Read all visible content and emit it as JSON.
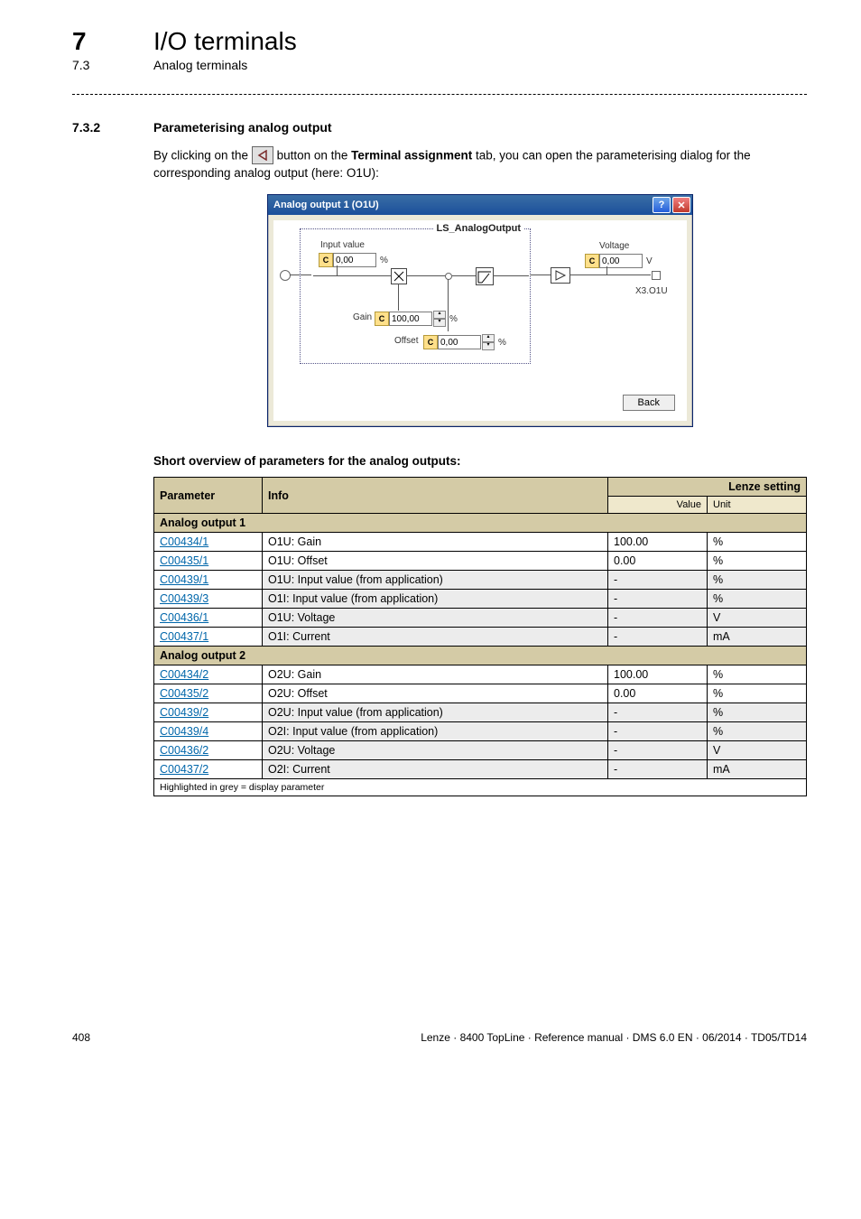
{
  "chapter": {
    "num": "7",
    "title": "I/O terminals"
  },
  "sub": {
    "num": "7.3",
    "title": "Analog terminals"
  },
  "section": {
    "num": "7.3.2",
    "title": "Parameterising analog output"
  },
  "intro": {
    "pre": "By clicking on the ",
    "mid": " button on the ",
    "tab_name": "Terminal assignment",
    "post": " tab, you can open the parameterising dialog for the corresponding analog output (here: O1U):"
  },
  "dialog": {
    "title": "Analog output 1 (O1U)",
    "group_label": "LS_AnalogOutput",
    "input_value_label": "Input value",
    "input_value_val": "0,00",
    "input_value_unit": "%",
    "gain_label": "Gain",
    "gain_val": "100,00",
    "gain_unit": "%",
    "offset_label": "Offset",
    "offset_val": "0,00",
    "offset_unit": "%",
    "voltage_label": "Voltage",
    "voltage_val": "0,00",
    "voltage_unit": "V",
    "connector": "X3.O1U",
    "back": "Back"
  },
  "overview_heading": "Short overview of parameters for the analog outputs:",
  "table": {
    "headers": {
      "param": "Parameter",
      "info": "Info",
      "lenze": "Lenze setting",
      "value": "Value",
      "unit": "Unit"
    },
    "group1": "Analog output 1",
    "group2": "Analog output 2",
    "footnote": "Highlighted in grey = display parameter",
    "rows1": [
      {
        "param": "C00434/1",
        "info": "O1U: Gain",
        "value": "100.00",
        "unit": "%",
        "grey": false
      },
      {
        "param": "C00435/1",
        "info": "O1U: Offset",
        "value": "0.00",
        "unit": "%",
        "grey": false
      },
      {
        "param": "C00439/1",
        "info": "O1U: Input value (from application)",
        "value": "-",
        "unit": "%",
        "grey": true
      },
      {
        "param": "C00439/3",
        "info": "O1I: Input value (from application)",
        "value": "-",
        "unit": "%",
        "grey": true
      },
      {
        "param": "C00436/1",
        "info": "O1U: Voltage",
        "value": "-",
        "unit": "V",
        "grey": true
      },
      {
        "param": "C00437/1",
        "info": "O1I: Current",
        "value": "-",
        "unit": "mA",
        "grey": true
      }
    ],
    "rows2": [
      {
        "param": "C00434/2",
        "info": "O2U: Gain",
        "value": "100.00",
        "unit": "%",
        "grey": false
      },
      {
        "param": "C00435/2",
        "info": "O2U: Offset",
        "value": "0.00",
        "unit": "%",
        "grey": false
      },
      {
        "param": "C00439/2",
        "info": "O2U: Input value (from application)",
        "value": "-",
        "unit": "%",
        "grey": true
      },
      {
        "param": "C00439/4",
        "info": "O2I: Input value (from application)",
        "value": "-",
        "unit": "%",
        "grey": true
      },
      {
        "param": "C00436/2",
        "info": "O2U: Voltage",
        "value": "-",
        "unit": "V",
        "grey": true
      },
      {
        "param": "C00437/2",
        "info": "O2I: Current",
        "value": "-",
        "unit": "mA",
        "grey": true
      }
    ]
  },
  "footer": {
    "page": "408",
    "doc": "Lenze · 8400 TopLine · Reference manual · DMS 6.0 EN · 06/2014 · TD05/TD14"
  }
}
